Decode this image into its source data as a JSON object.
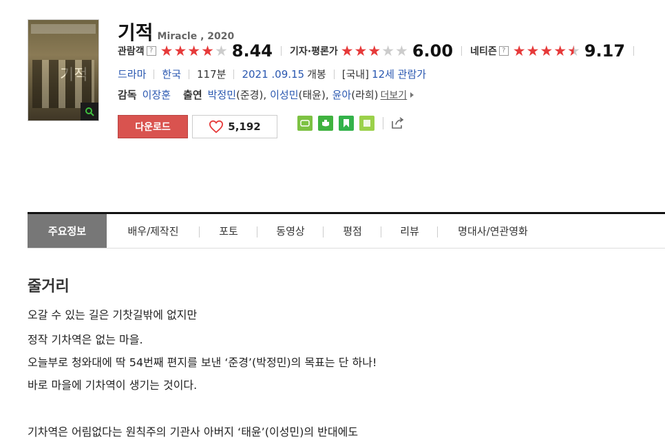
{
  "movie": {
    "title": "기적",
    "title_en": "Miracle , 2020"
  },
  "ratings": [
    {
      "label": "관람객",
      "score": "8.44",
      "stars": 4.22
    },
    {
      "label": "기자·평론가",
      "score": "6.00",
      "stars": 3.0
    },
    {
      "label": "네티즌",
      "score": "9.17",
      "stars": 4.6
    }
  ],
  "info": {
    "genre": "드라마",
    "country": "한국",
    "runtime": "117분",
    "release_date": "2021 .09.15",
    "release_suffix": "개봉",
    "rating_prefix": "[국내]",
    "rating": "12세 관람가"
  },
  "credits": {
    "director_label": "감독",
    "director": "이장훈",
    "cast_label": "출연",
    "cast": [
      {
        "name": "박정민",
        "role": "(준경)"
      },
      {
        "name": "이성민",
        "role": "(태윤)"
      },
      {
        "name": "윤아",
        "role": "(라희)"
      }
    ],
    "cast_sep": ",",
    "more": "더보기"
  },
  "actions": {
    "download_label": "다운로드",
    "like_count": "5,192",
    "share_icons": [
      "band-icon",
      "naver-blog-icon",
      "bookmark-icon",
      "memo-icon",
      "share-icon"
    ]
  },
  "tabs": [
    "주요정보",
    "배우/제작진",
    "포토",
    "동영상",
    "평점",
    "리뷰",
    "명대사/연관영화"
  ],
  "synopsis": {
    "heading": "줄거리",
    "lines": [
      "오갈 수 있는 길은 기찻길밖에 없지만",
      " 정작 기차역은 없는 마을.",
      " 오늘부로 청와대에 딱 54번째 편지를 보낸 ‘준경’(박정민)의 목표는 단 하나!",
      " 바로 마을에 기차역이 생기는 것이다.",
      "",
      " 기차역은 어림없다는 원칙주의 기관사 아버지 ‘태윤’(이성민)의 반대에도"
    ]
  },
  "colors": {
    "star_on": "#e63a3a",
    "star_off": "#cccccc",
    "link": "#2957b0",
    "download_bg": "#d9534f",
    "tab_active_bg": "#777777"
  }
}
